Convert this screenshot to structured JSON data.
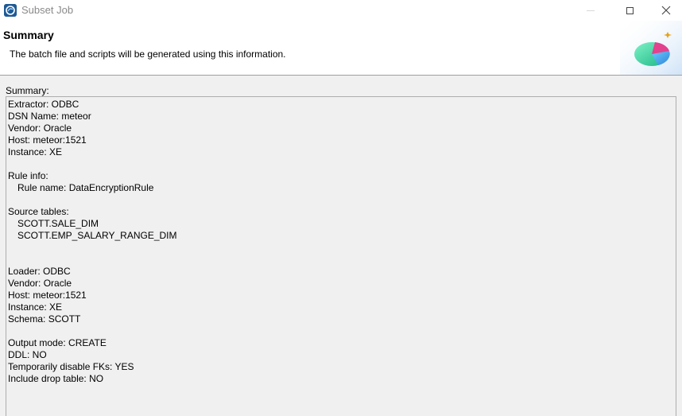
{
  "window": {
    "title": "Subset Job"
  },
  "header": {
    "title": "Summary",
    "description": "The batch file and scripts will be generated using this information."
  },
  "summary": {
    "label": "Summary:",
    "extractor": {
      "extractor": "Extractor: ODBC",
      "dsn": "DSN Name: meteor",
      "vendor": "Vendor: Oracle",
      "host": "Host: meteor:1521",
      "instance": "Instance: XE"
    },
    "rule": {
      "heading": "Rule info:",
      "name": "Rule name: DataEncryptionRule"
    },
    "source": {
      "heading": "Source tables:",
      "tables": [
        "SCOTT.SALE_DIM",
        "SCOTT.EMP_SALARY_RANGE_DIM"
      ]
    },
    "loader": {
      "loader": "Loader: ODBC",
      "vendor": "Vendor: Oracle",
      "host": "Host: meteor:1521",
      "instance": "Instance: XE",
      "schema": "Schema: SCOTT"
    },
    "output": {
      "mode": "Output mode: CREATE",
      "ddl": "DDL: NO",
      "disable_fks": "Temporarily disable FKs: YES",
      "drop_table": "Include drop table: NO"
    }
  },
  "colors": {
    "background": "#f0f0f0",
    "header_background": "#ffffff",
    "border": "#adadad",
    "title_text": "#8a8a8a"
  },
  "icons": {
    "app": "app-logo-icon",
    "minimize": "minimize-icon",
    "maximize": "maximize-icon",
    "close": "close-icon",
    "wizard": "wizard-banner-graphic"
  }
}
